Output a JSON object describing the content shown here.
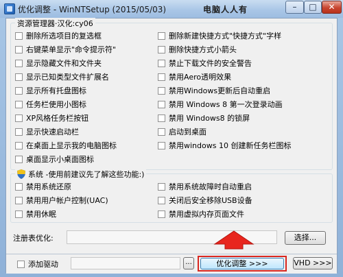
{
  "window": {
    "title": "优化调整 - WinNTSetup (2015/05/03)",
    "watermark": "电脑人人有",
    "minimize_glyph": "–",
    "maximize_glyph": "□",
    "close_glyph": "✕"
  },
  "explorer_group": {
    "title": "资源管理器·汉化:cy06",
    "left_items": [
      "删除所选项目的复选框",
      "右键菜单显示\"命令提示符\"",
      "显示隐藏文件和文件夹",
      "显示已知类型文件扩展名",
      "显示所有托盘图标",
      "任务栏使用小图标",
      "XP风格任务栏按钮",
      "显示快速启动栏",
      "在桌面上显示我的电脑图标",
      "桌面显示小桌面图标"
    ],
    "right_items": [
      "删除新建快捷方式\"快捷方式\"字样",
      "删除快捷方式小箭头",
      "禁止下载文件的安全警告",
      "禁用Aero透明效果",
      "禁用Windows更新后自动重启",
      "禁用 Windows 8 第一次登录动画",
      "禁用 Windows8 的锁屏",
      "启动到桌面",
      "禁用windows 10 创建新任务栏图标"
    ]
  },
  "system_group": {
    "title": "系统 -使用前建议先了解这些功能:)",
    "left_items": [
      "禁用系统还原",
      "禁用用户帐户控制(UAC)",
      "禁用休眠"
    ],
    "right_items": [
      "禁用系统故障时自动重启",
      "关闭后安全移除USB设备",
      "禁用虚拟内存页面文件"
    ]
  },
  "registry": {
    "label": "注册表优化:",
    "value": "",
    "browse_label": "选择..."
  },
  "bottom": {
    "add_driver_label": "添加驱动",
    "driver_browse_label": "...",
    "optimize_label": "优化调整 >>>",
    "vhd_label": "VHD >>>"
  },
  "colors": {
    "highlight_border": "#d8261f",
    "arrow_fill": "#e8261e"
  }
}
